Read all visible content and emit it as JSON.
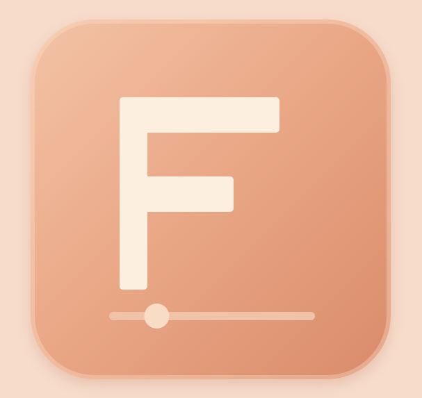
{
  "logo": {
    "letter": "F",
    "letter_color": "#fcefdf",
    "background_colors": [
      "#f3c3a6",
      "#eaa988",
      "#d98b6a"
    ],
    "page_background": "#f7dccb"
  },
  "slider": {
    "value_percent": 22,
    "track_color": "#f0c2a8",
    "thumb_color": "#f9dcc6"
  },
  "icons": [
    "app-icon",
    "f-letter-icon",
    "slider-icon"
  ]
}
